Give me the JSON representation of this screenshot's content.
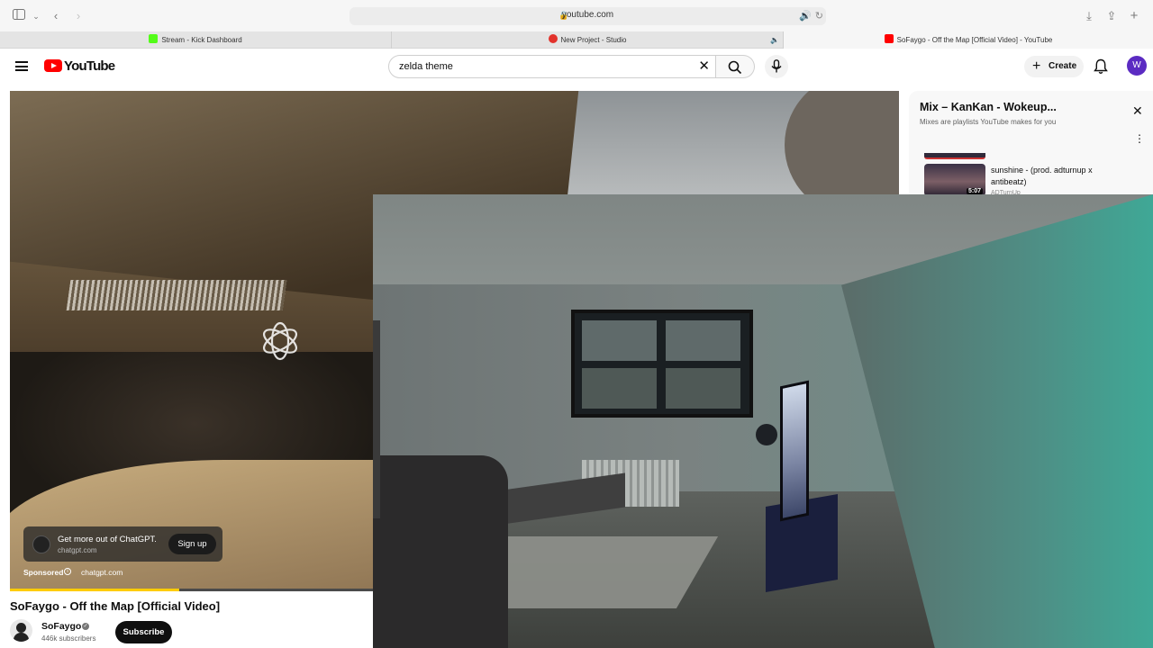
{
  "browser": {
    "url": "youtube.com",
    "tabs": [
      {
        "label": "Stream - Kick Dashboard",
        "favicon_color": "#53fc18"
      },
      {
        "label": "New Project - Studio",
        "favicon_color": "#e2322b"
      },
      {
        "label": "SoFaygo - Off the Map [Official Video] - YouTube",
        "favicon_color": "#ff0000"
      }
    ]
  },
  "header": {
    "logo_text": "YouTube",
    "search_value": "zelda theme",
    "create_label": "Create",
    "avatar_letter": "W",
    "avatar_color": "#5b2bc2"
  },
  "ad": {
    "title": "Get more out of ChatGPT.",
    "domain": "chatgpt.com",
    "cta": "Sign up",
    "sponsored_label": "Sponsored",
    "sponsored_domain": "chatgpt.com",
    "progress_fraction": 0.19
  },
  "video": {
    "title": "SoFaygo - Off the Map [Official Video]",
    "channel": "SoFaygo",
    "subscribers": "446k subscribers",
    "subscribe_label": "Subscribe"
  },
  "mix": {
    "title": "Mix – KanKan - Wokeup...",
    "subtitle": "Mixes are playlists YouTube makes for you",
    "items": [
      {
        "title": "sunshine - (prod. adturnup x antibeatz)",
        "artist": "ADTurnUp",
        "duration": "5:07"
      }
    ]
  }
}
